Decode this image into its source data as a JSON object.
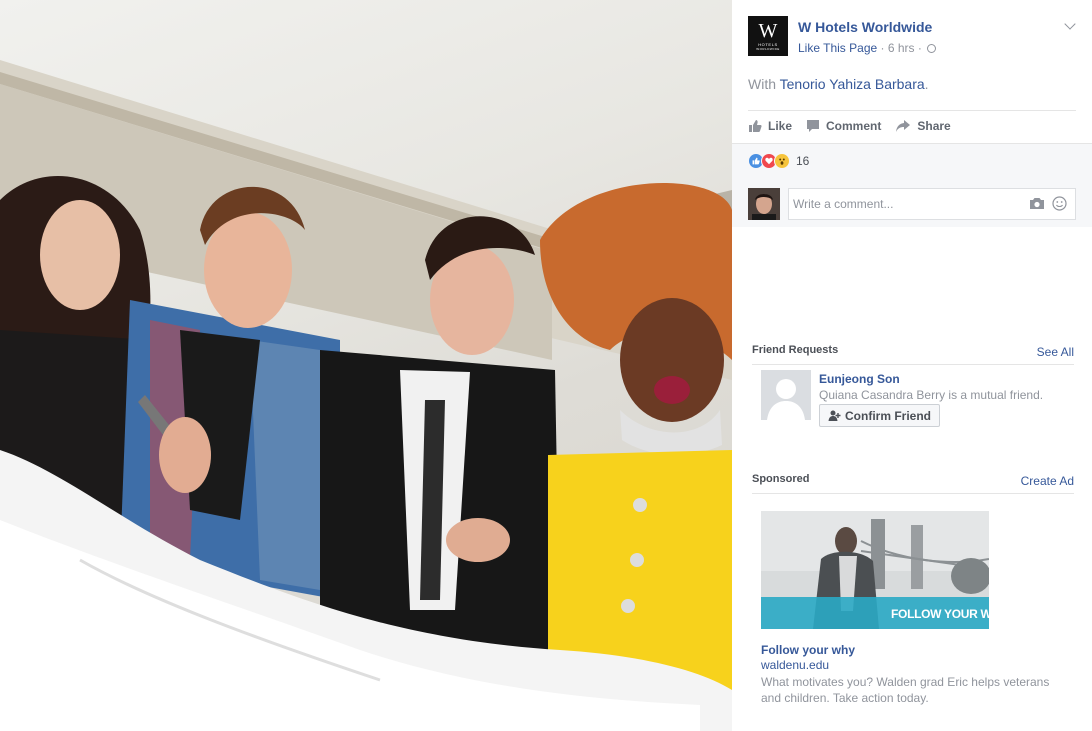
{
  "post": {
    "page_name": "W Hotels Worldwide",
    "logo_letter": "W",
    "logo_sub1": "HOTELS",
    "logo_sub2": "WORLDWIDE",
    "like_page": "Like This Page",
    "separator": " · ",
    "time": "6 hrs",
    "with_prefix": "With ",
    "tagged": "Tenorio Yahiza Barbara",
    "with_suffix": ".",
    "actions": {
      "like": "Like",
      "comment": "Comment",
      "share": "Share"
    },
    "reaction_count": "16",
    "comment_placeholder": "Write a comment..."
  },
  "friend_requests": {
    "title": "Friend Requests",
    "see_all": "See All",
    "name": "Eunjeong Son",
    "mutual": "Quiana Casandra Berry is a mutual friend.",
    "confirm": "Confirm Friend"
  },
  "sponsored": {
    "title": "Sponsored",
    "create_ad": "Create Ad",
    "ad_overlay": "FOLLOW YOUR WHY.",
    "ad_title": "Follow your why",
    "ad_domain": "waldenu.edu",
    "ad_desc": "What motivates you? Walden grad Eric helps veterans and children. Take action today."
  },
  "colors": {
    "link": "#365899",
    "muted": "#90949c",
    "dress_yellow": "#f7d21c",
    "like_blue": "#4a90e2",
    "love_red": "#f0484e",
    "ad_teal": "#2aa8c4"
  },
  "icons": [
    "globe-icon",
    "chevron-down-icon",
    "thumbs-up-icon",
    "comment-icon",
    "share-icon",
    "camera-icon",
    "smiley-icon",
    "add-friend-icon"
  ]
}
